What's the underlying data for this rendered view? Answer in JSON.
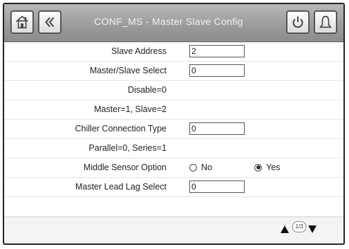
{
  "header": {
    "title": "CONF_MS  -  Master Slave Config",
    "home_icon": "home-icon",
    "back_icon": "back-chevron-icon",
    "power_icon": "power-icon",
    "alarm_icon": "bell-icon"
  },
  "fields": {
    "slave_address": {
      "label": "Slave Address",
      "value": "2"
    },
    "master_slave_select": {
      "label": "Master/Slave Select",
      "value": "0"
    },
    "disable_note": {
      "label": "Disable=0"
    },
    "master_slave_note": {
      "label": "Master=1, Slave=2"
    },
    "chiller_connection_type": {
      "label": "Chiller Connection Type",
      "value": "0"
    },
    "connection_note": {
      "label": "Parallel=0, Series=1"
    },
    "middle_sensor_option": {
      "label": "Middle Sensor Option",
      "option_no": "No",
      "option_yes": "Yes",
      "selected": "Yes"
    },
    "master_lead_lag_select": {
      "label": "Master Lead Lag Select",
      "value": "0"
    }
  },
  "footer": {
    "page": "1/3"
  }
}
